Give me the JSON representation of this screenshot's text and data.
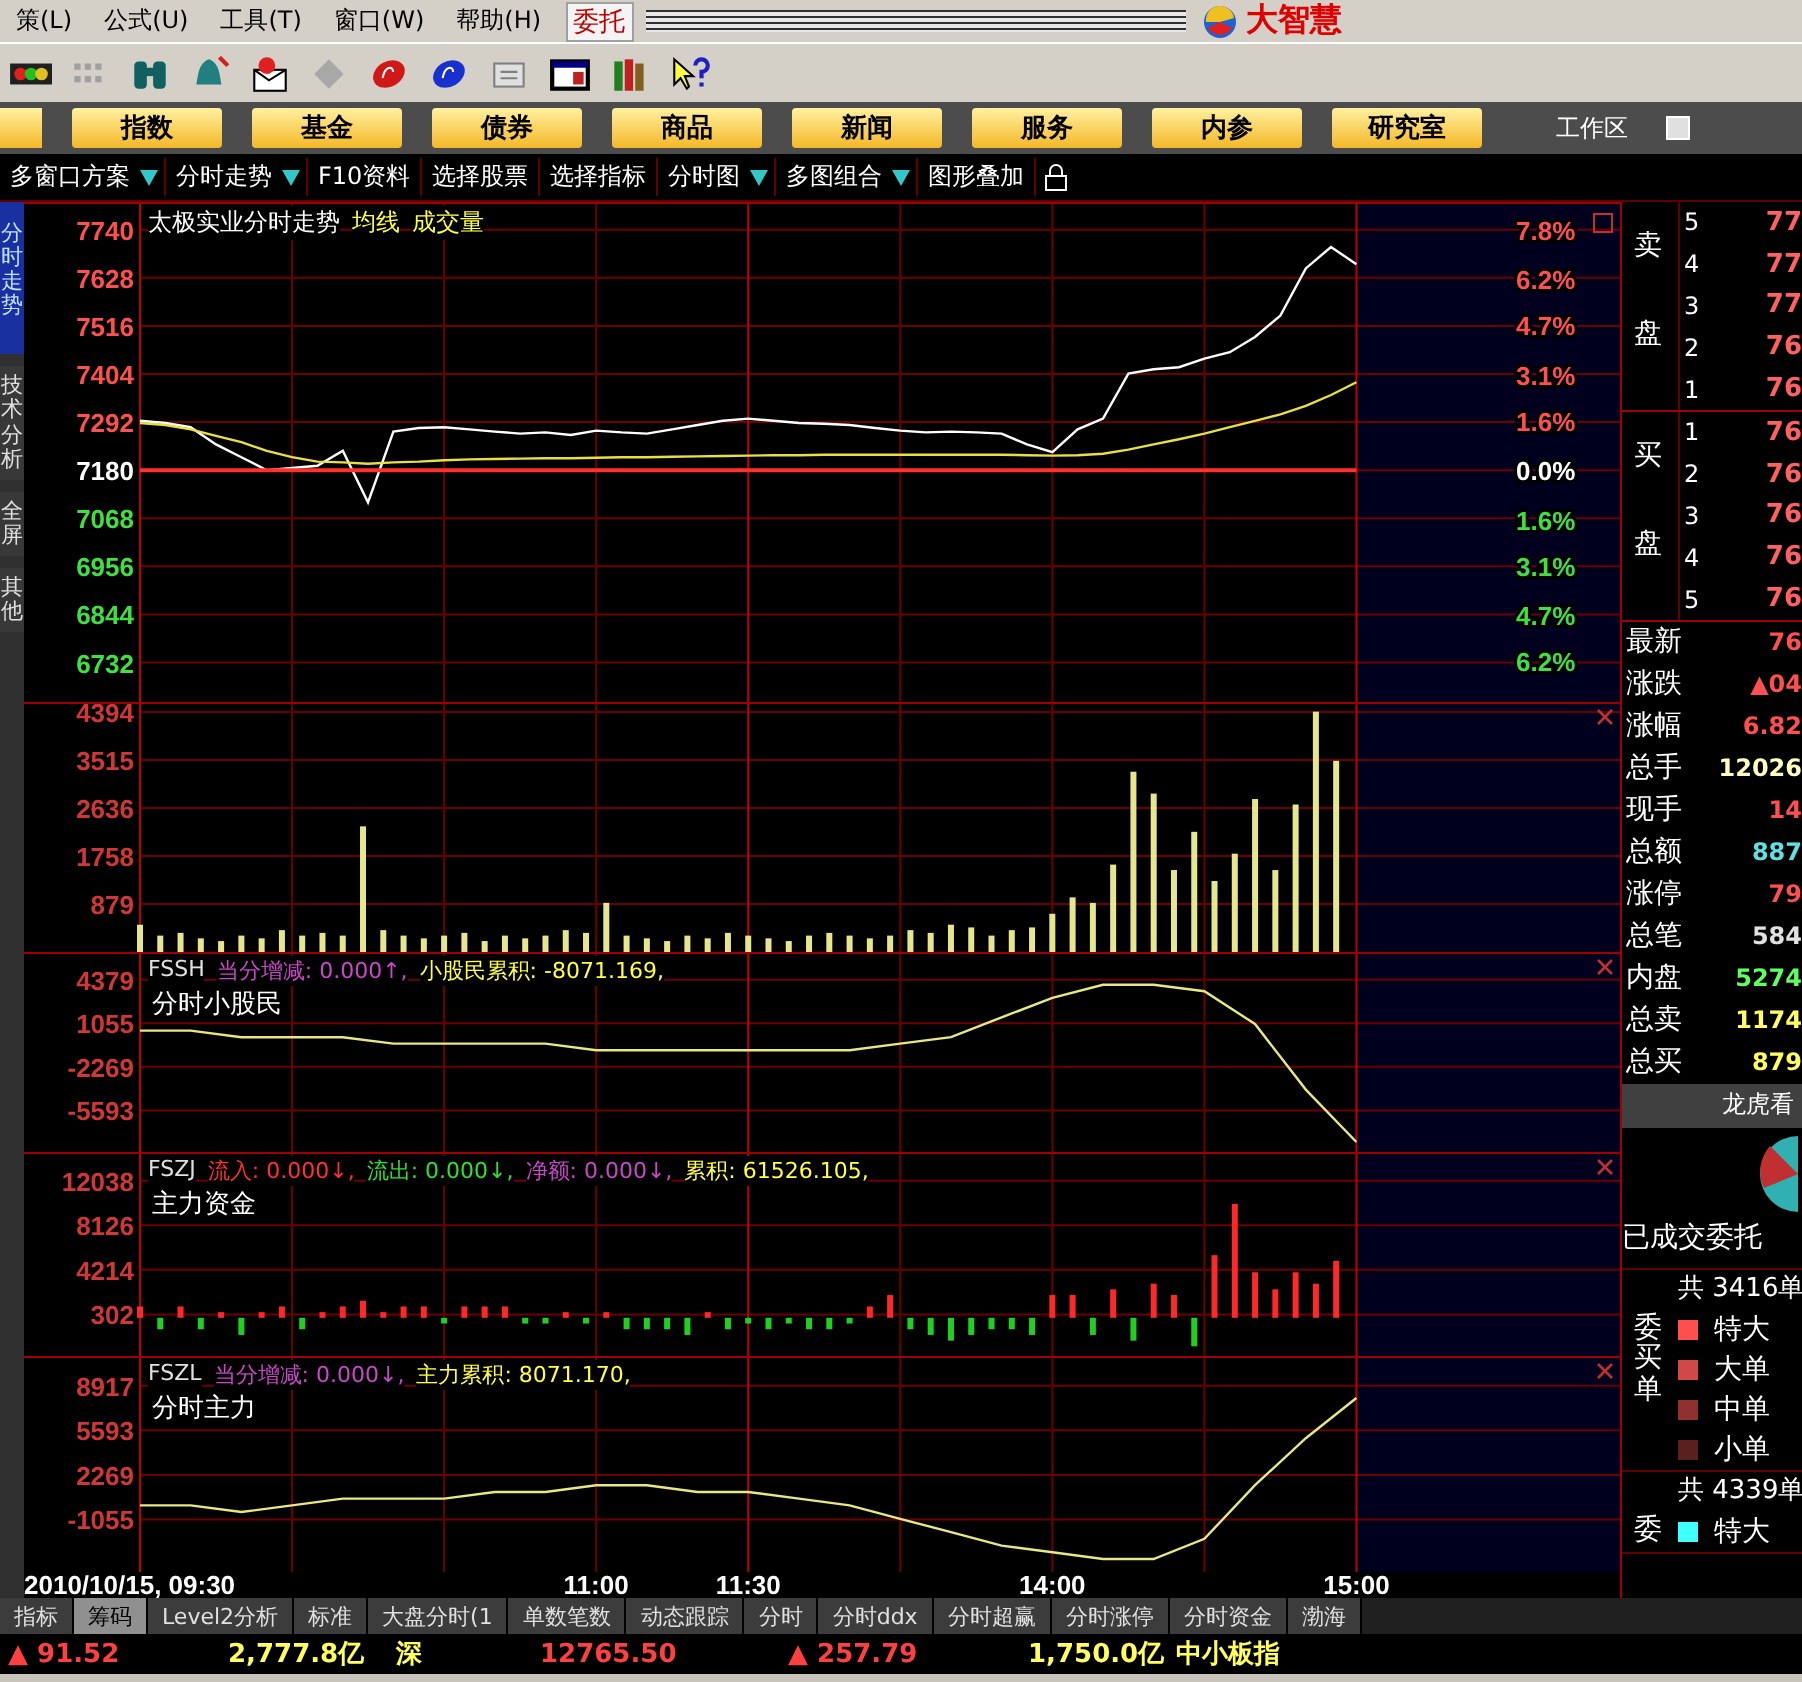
{
  "menu_bar": {
    "items": [
      "策(L)",
      "公式(U)",
      "工具(T)",
      "窗口(W)",
      "帮助(H)"
    ],
    "entrust": "委托",
    "brand": "大智慧"
  },
  "nav_buttons": [
    "指数",
    "基金",
    "债券",
    "商品",
    "新闻",
    "服务",
    "内参",
    "研究室"
  ],
  "workspace_label": "工作区",
  "sub_toolbar": [
    {
      "label": "多窗口方案",
      "dropdown": true
    },
    {
      "label": "分时走势",
      "dropdown": true
    },
    {
      "label": "F10资料",
      "dropdown": false
    },
    {
      "label": "选择股票",
      "dropdown": false
    },
    {
      "label": "选择指标",
      "dropdown": false
    },
    {
      "label": "分时图",
      "dropdown": true
    },
    {
      "label": "多图组合",
      "dropdown": true
    },
    {
      "label": "图形叠加",
      "dropdown": false
    }
  ],
  "side_tabs": [
    {
      "label": "分时走势",
      "selected": true
    },
    {
      "label": "技术分析",
      "selected": false
    },
    {
      "label": "全屏",
      "selected": false
    },
    {
      "label": "其他",
      "selected": false
    }
  ],
  "panels": [
    {
      "kind": "price",
      "header": [
        {
          "text": "太极实业分时走势",
          "color": "#ffffff"
        },
        {
          "text": "均线",
          "color": "#ffff40"
        },
        {
          "text": "成交量",
          "color": "#ffff40"
        }
      ],
      "chart_data": {
        "type": "line",
        "series": [
          {
            "color": "#ffffff",
            "values": [
              7295,
              7290,
              7280,
              7240,
              7210,
              7180,
              7185,
              7190,
              7225,
              7105,
              7270,
              7278,
              7280,
              7275,
              7270,
              7265,
              7268,
              7262,
              7272,
              7268,
              7265,
              7275,
              7285,
              7295,
              7300,
              7295,
              7290,
              7288,
              7285,
              7278,
              7272,
              7268,
              7270,
              7268,
              7265,
              7240,
              7222,
              7275,
              7300,
              7405,
              7415,
              7420,
              7440,
              7455,
              7490,
              7540,
              7650,
              7700,
              7660
            ]
          },
          {
            "color": "#e8e040",
            "values": [
              7290,
              7285,
              7275,
              7260,
              7245,
              7225,
              7210,
              7200,
              7198,
              7195,
              7198,
              7200,
              7203,
              7205,
              7206,
              7207,
              7208,
              7208,
              7209,
              7210,
              7210,
              7211,
              7212,
              7213,
              7214,
              7215,
              7215,
              7216,
              7216,
              7216,
              7216,
              7216,
              7216,
              7216,
              7216,
              7215,
              7214,
              7215,
              7218,
              7228,
              7240,
              7252,
              7265,
              7280,
              7295,
              7310,
              7330,
              7355,
              7385
            ]
          },
          {
            "color": "#ff3030",
            "values": [
              7180,
              7180,
              7180,
              7180,
              7180,
              7180,
              7180,
              7180,
              7180,
              7180,
              7180,
              7180,
              7180,
              7180,
              7180,
              7180,
              7180,
              7180,
              7180,
              7180,
              7180,
              7180,
              7180,
              7180,
              7180,
              7180,
              7180,
              7180,
              7180,
              7180,
              7180,
              7180,
              7180,
              7180,
              7180,
              7180,
              7180,
              7180,
              7180,
              7180,
              7180,
              7180,
              7180,
              7180,
              7180,
              7180,
              7180,
              7180,
              7180
            ]
          }
        ],
        "ylim": [
          6640,
          7800
        ],
        "yticks": [
          7740,
          7628,
          7516,
          7404,
          7292,
          7180,
          7068,
          6956,
          6844,
          6732
        ],
        "y2lim": [
          -7.52,
          8.64
        ],
        "y2ticks": [
          {
            "value": 7.8,
            "label": "7.8%"
          },
          {
            "value": 6.2,
            "label": "6.2%"
          },
          {
            "value": 4.7,
            "label": "4.7%"
          },
          {
            "value": 3.1,
            "label": "3.1%"
          },
          {
            "value": 1.6,
            "label": "1.6%"
          },
          {
            "value": 0,
            "label": "0.0%"
          },
          {
            "value": -1.6,
            "label": "1.6%"
          },
          {
            "value": -3.1,
            "label": "3.1%"
          },
          {
            "value": -4.7,
            "label": "4.7%"
          },
          {
            "value": -6.2,
            "label": "6.2%"
          }
        ],
        "grid": true
      }
    },
    {
      "kind": "volume",
      "chart_data": {
        "type": "bar",
        "series": [
          {
            "color": "#e6e68c",
            "values": [
              500,
              300,
              350,
              250,
              200,
              300,
              250,
              400,
              300,
              350,
              300,
              2300,
              400,
              300,
              250,
              300,
              350,
              200,
              300,
              250,
              300,
              400,
              350,
              900,
              300,
              250,
              200,
              300,
              250,
              350,
              300,
              250,
              200,
              300,
              350,
              300,
              250,
              300,
              400,
              350,
              500,
              450,
              300,
              400,
              450,
              700,
              1000,
              900,
              1600,
              3300,
              2900,
              1500,
              2200,
              1300,
              1800,
              2800,
              1500,
              2700,
              4400,
              3500
            ]
          }
        ],
        "ylim": [
          0,
          4540
        ],
        "yticks": [
          4394,
          3515,
          2636,
          1758,
          879
        ],
        "grid": true
      }
    },
    {
      "kind": "indicator",
      "header": [
        {
          "text": "FSSH",
          "color": "#e0e0e0"
        },
        {
          "text": "当分增减: 0.000↑,",
          "color": "#c848c8"
        },
        {
          "text": "小股民累积: -8071.169,",
          "color": "#ffff40"
        }
      ],
      "subtitle": "分时小股民",
      "chart_data": {
        "type": "line",
        "series": [
          {
            "color": "#e8e880",
            "values": [
              500,
              500,
              0,
              0,
              0,
              -500,
              -500,
              -500,
              -500,
              -1000,
              -1000,
              -1000,
              -1000,
              -1000,
              -1000,
              -500,
              0,
              1500,
              3000,
              4000,
              4000,
              3500,
              1000,
              -4000,
              -8000
            ]
          }
        ],
        "ylim": [
          -8766,
          6343
        ],
        "grid": true,
        "yticks": [
          {
            "value": 4379,
            "label": "4379"
          },
          {
            "value": 1055,
            "label": "1055"
          },
          {
            "value": -2269,
            "label": "-2269"
          },
          {
            "value": -5593,
            "label": "-5593"
          }
        ]
      }
    },
    {
      "kind": "indicator",
      "header": [
        {
          "text": "FSZJ",
          "color": "#e0e0e0"
        },
        {
          "text": "流入: 0.000↓,",
          "color": "#ff3030"
        },
        {
          "text": "流出: 0.000↓,",
          "color": "#30e030"
        },
        {
          "text": "净额: 0.000↓,",
          "color": "#c848c8"
        },
        {
          "text": "累积: 61526.105,",
          "color": "#ffff40"
        }
      ],
      "subtitle": "主力资金",
      "chart_data": {
        "type": "bar",
        "series": [
          {
            "color": "#ff2828",
            "values": [
              1000,
              null,
              1000,
              null,
              500,
              null,
              500,
              1000,
              null,
              500,
              1000,
              1500,
              500,
              1000,
              1000,
              null,
              1000,
              1000,
              1000,
              null,
              null,
              500,
              null,
              500,
              null,
              null,
              null,
              null,
              500,
              null,
              null,
              null,
              null,
              null,
              null,
              null,
              1000,
              2000,
              null,
              null,
              null,
              null,
              null,
              null,
              null,
              2000,
              2000,
              null,
              2500,
              null,
              3000,
              2000,
              null,
              5500,
              10000,
              4000,
              2500,
              4000,
              3000,
              5000
            ]
          },
          {
            "color": "#20d020",
            "values": [
              null,
              -1000,
              null,
              -1000,
              null,
              -1500,
              null,
              null,
              -1000,
              null,
              null,
              null,
              null,
              null,
              null,
              -500,
              null,
              null,
              null,
              -500,
              -500,
              null,
              -500,
              null,
              -1000,
              -1000,
              -1000,
              -1500,
              null,
              -1000,
              -500,
              -1000,
              -500,
              -1000,
              -1000,
              -500,
              null,
              null,
              -1000,
              -1500,
              -2000,
              -1500,
              -1000,
              -1000,
              -1500,
              null,
              null,
              -1500,
              null,
              -2000,
              null,
              null,
              -2500,
              null,
              null,
              null,
              null,
              null,
              null,
              null
            ]
          }
        ],
        "ylim": [
          -3350,
          14380
        ],
        "grid": true,
        "yticks": [
          12038,
          8126,
          4214,
          302
        ]
      }
    },
    {
      "kind": "indicator",
      "header": [
        {
          "text": "FSZL",
          "color": "#e0e0e0"
        },
        {
          "text": "当分增减: 0.000↓,",
          "color": "#c848c8"
        },
        {
          "text": "主力累积: 8071.170,",
          "color": "#ffff40"
        }
      ],
      "subtitle": "分时主力",
      "chart_data": {
        "type": "line",
        "categories": [
          "2010/10/15, 09:30",
          null,
          null,
          null,
          null,
          null,
          null,
          null,
          null,
          "11:00",
          null,
          null,
          "11:30",
          null,
          null,
          null,
          null,
          null,
          "14:00",
          null,
          null,
          null,
          null,
          null,
          "15:00"
        ],
        "series": [
          {
            "color": "#e8e880",
            "values": [
              0,
              0,
              -500,
              0,
              500,
              500,
              500,
              1000,
              1000,
              1500,
              1500,
              1000,
              1000,
              500,
              0,
              -1000,
              -2000,
              -3000,
              -3500,
              -4000,
              -4000,
              -2500,
              1500,
              5000,
              8000
            ]
          }
        ],
        "ylim": [
          -4970,
          10985
        ],
        "grid": true,
        "yticks": [
          {
            "value": 8917,
            "label": "8917"
          },
          {
            "value": 5593,
            "label": "5593"
          },
          {
            "value": 2269,
            "label": "2269"
          },
          {
            "value": -1055,
            "label": "-1055"
          }
        ]
      }
    }
  ],
  "order_book": [
    {
      "label": "卖盘",
      "rows": [
        {
          "rank": "5",
          "price": "77"
        },
        {
          "rank": "4",
          "price": "77"
        },
        {
          "rank": "3",
          "price": "77"
        },
        {
          "rank": "2",
          "price": "76"
        },
        {
          "rank": "1",
          "price": "76"
        }
      ]
    },
    {
      "label": "买盘",
      "rows": [
        {
          "rank": "1",
          "price": "76"
        },
        {
          "rank": "2",
          "price": "76"
        },
        {
          "rank": "3",
          "price": "76"
        },
        {
          "rank": "4",
          "price": "76"
        },
        {
          "rank": "5",
          "price": "76"
        }
      ]
    }
  ],
  "quote_stats": [
    {
      "label": "最新",
      "value": "76",
      "color": "#ff5050"
    },
    {
      "label": "涨跌",
      "value": "▲04",
      "color": "#ff5050"
    },
    {
      "label": "涨幅",
      "value": "6.82",
      "color": "#ff5050"
    },
    {
      "label": "总手",
      "value": "12026",
      "color": "#ffffc0"
    },
    {
      "label": "现手",
      "value": "14",
      "color": "#ff5050"
    },
    {
      "label": "总额",
      "value": "887",
      "color": "#60e0e0"
    },
    {
      "label": "涨停",
      "value": "79",
      "color": "#ff5050"
    },
    {
      "label": "总笔",
      "value": "584",
      "color": "#e0e0e0"
    },
    {
      "label": "内盘",
      "value": "5274",
      "color": "#60ff60"
    },
    {
      "label": "总卖",
      "value": "1174",
      "color": "#ffff60"
    },
    {
      "label": "总买",
      "value": "879",
      "color": "#ffff60"
    }
  ],
  "order_flow": {
    "tab": "龙虎看",
    "caption": "已成交委托",
    "groups": [
      {
        "label": "委买单",
        "total": "共 3416单",
        "items": [
          {
            "label": "特大",
            "color": "#ff5050"
          },
          {
            "label": "大单",
            "color": "#d04848"
          },
          {
            "label": "中单",
            "color": "#903030"
          },
          {
            "label": "小单",
            "color": "#5a2020"
          }
        ]
      },
      {
        "label": "委",
        "total": "共 4339单",
        "items": [
          {
            "label": "特大",
            "color": "#40ffff"
          }
        ]
      }
    ]
  },
  "bottom_tabs": [
    {
      "label": "指标",
      "selected": false
    },
    {
      "label": "筹码",
      "selected": true
    },
    {
      "label": "Level2分析",
      "selected": false
    },
    {
      "label": "标准",
      "selected": false
    },
    {
      "label": "大盘分时(1",
      "selected": false
    },
    {
      "label": "单数笔数",
      "selected": false
    },
    {
      "label": "动态跟踪",
      "selected": false
    },
    {
      "label": "分时",
      "selected": false
    },
    {
      "label": "分时ddx",
      "selected": false
    },
    {
      "label": "分时超赢",
      "selected": false
    },
    {
      "label": "分时涨停",
      "selected": false
    },
    {
      "label": "分时资金",
      "selected": false
    },
    {
      "label": "渤海",
      "selected": false
    }
  ],
  "status_bar": [
    {
      "text": "▲ 91.52",
      "color": "#ff4040"
    },
    {
      "text": "2,777.8亿",
      "color": "#ffff60"
    },
    {
      "text": "深",
      "color": "#ffff60"
    },
    {
      "text": "12765.50",
      "color": "#ff4040"
    },
    {
      "text": "▲ 257.79",
      "color": "#ff4040"
    },
    {
      "text": "1,750.0亿",
      "color": "#ffff60"
    },
    {
      "text": "中小板指",
      "color": "#ffff60"
    }
  ]
}
